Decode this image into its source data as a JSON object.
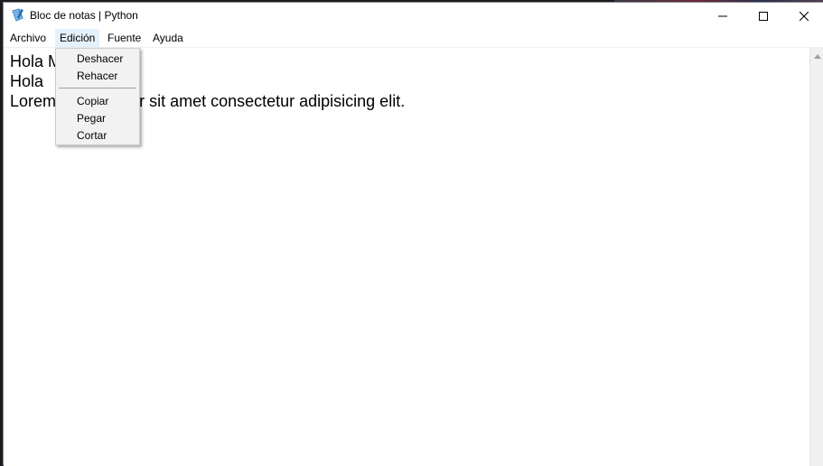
{
  "window": {
    "title": "Bloc de notas | Python",
    "icon": "notepad-app-icon"
  },
  "caption_buttons": {
    "minimize_icon": "minimize-icon",
    "maximize_icon": "maximize-icon",
    "close_icon": "close-icon"
  },
  "menubar": {
    "items": [
      {
        "label": "Archivo"
      },
      {
        "label": "Edición"
      },
      {
        "label": "Fuente"
      },
      {
        "label": "Ayuda"
      }
    ],
    "open_menu": "Edición"
  },
  "edit_menu": {
    "items": [
      {
        "label": "Deshacer"
      },
      {
        "label": "Rehacer"
      },
      {
        "label": "Copiar"
      },
      {
        "label": "Pegar"
      },
      {
        "label": "Cortar"
      }
    ]
  },
  "editor": {
    "lines": [
      "Hola Mundo",
      "Hola",
      "Lorem ipsum dolor sit amet consectetur adipisicing elit."
    ]
  },
  "colors": {
    "menu_open_bg": "#e5f1fb",
    "dropdown_bg": "#f2f2f2"
  }
}
